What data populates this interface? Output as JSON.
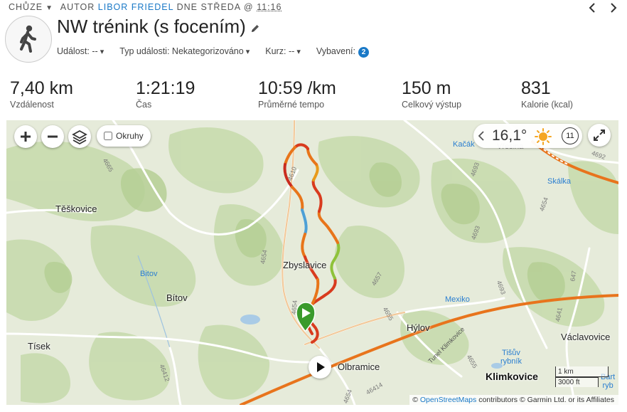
{
  "meta": {
    "activity_type": "CHŮZE",
    "author_prefix": "AUTOR",
    "author": "LIBOR FRIEDEL",
    "day_text": "DNE STŘEDA @",
    "time": "11:16"
  },
  "header": {
    "title": "NW trénink (s focením)",
    "filters": {
      "event_label": "Událost:",
      "event_value": "--",
      "event_type_label": "Typ události:",
      "event_type_value": "Nekategorizováno",
      "course_label": "Kurz:",
      "course_value": "--",
      "gear_label": "Vybavení:",
      "gear_count": "2"
    }
  },
  "stats": [
    {
      "value": "7,40 km",
      "label": "Vzdálenost"
    },
    {
      "value": "1:21:19",
      "label": "Čas"
    },
    {
      "value": "10:59 /km",
      "label": "Průměrné tempo"
    },
    {
      "value": "150 m",
      "label": "Celkový výstup"
    },
    {
      "value": "831",
      "label": "Kalorie (kcal)"
    }
  ],
  "map": {
    "layer_toggle_label": "Okruhy",
    "weather": {
      "temperature": "16,1°",
      "wind_speed": "11"
    },
    "towns": {
      "teskovice": "Těškovice",
      "bitov": "Bítov",
      "tisek": "Tísek",
      "zbyslavice": "Zbyslavice",
      "hylov": "Hýlov",
      "olbramice": "Olbramice",
      "klimkovice": "Klimkovice",
      "vaclavovice": "Václavovice",
      "kacak": "Kačák",
      "vresina": "Vřesina",
      "skalka": "Skálka",
      "mexiko": "Mexiko"
    },
    "water": {
      "bitov": "Bitov",
      "tisuv_1": "Tišův",
      "tisuv_2": "rybník",
      "bartosuv_1": "Bart",
      "bartosuv_2": "ryb"
    },
    "roads": {
      "r4665": "4665",
      "r4610": "4610",
      "r4654a": "4654",
      "r4654b": "4654",
      "r4657": "4657",
      "r4655": "4655",
      "r4693a": "4693",
      "r4693b": "4693",
      "r4692": "4692",
      "r4654c": "4654",
      "r4693c": "4693",
      "r4655b": "4655",
      "r4641": "4641",
      "r647": "647",
      "r46412": "46412",
      "r46414": "46414",
      "r4654d": "4654",
      "tunnel": "Tunel Klimkovice"
    },
    "scale": {
      "metric": "1 km",
      "imperial": "3000 ft"
    },
    "attribution": {
      "copyright": "©",
      "osm_link": "OpenStreetMaps",
      "rest": "contributors © Garmin Ltd. or its Affiliates"
    }
  }
}
